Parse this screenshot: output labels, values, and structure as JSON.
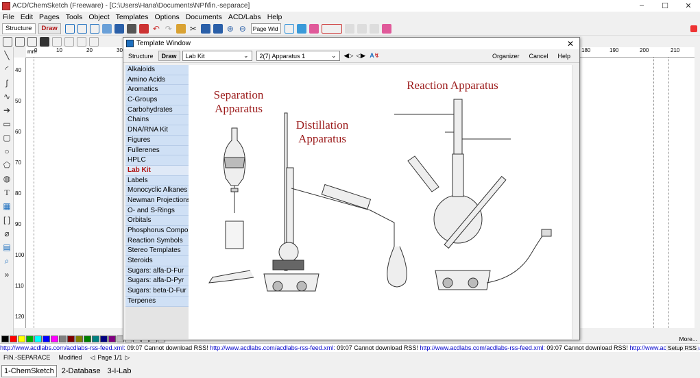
{
  "window": {
    "title": "ACD/ChemSketch (Freeware) - [C:\\Users\\Hana\\Documents\\NPI\\fin.-separace]",
    "controls": [
      "–",
      "☐",
      "✕"
    ]
  },
  "menu": [
    "File",
    "Edit",
    "Pages",
    "Tools",
    "Object",
    "Templates",
    "Options",
    "Documents",
    "ACD/Labs",
    "Help"
  ],
  "toolbar": {
    "structure_label": "Structure",
    "draw_label": "Draw",
    "zoom_value": "Page Wid"
  },
  "ruler": {
    "unit": "mm",
    "h_labels": [
      "0",
      "10",
      "20",
      "30",
      "180",
      "190",
      "200",
      "210"
    ],
    "v_labels": [
      "40",
      "50",
      "60",
      "70",
      "80",
      "90",
      "100",
      "110",
      "120"
    ]
  },
  "template_window": {
    "title": "Template Window",
    "structure_label": "Structure",
    "draw_label": "Draw",
    "category_value": "Lab Kit",
    "page_value": "2(7) Apparatus 1",
    "organizer_label": "Organizer",
    "cancel_label": "Cancel",
    "help_label": "Help",
    "list": [
      "Alkaloids",
      "Amino Acids",
      "Aromatics",
      "C-Groups",
      "Carbohydrates",
      "Chains",
      "DNA/RNA Kit",
      "Figures",
      "Fullerenes",
      "HPLC",
      "Lab Kit",
      "Labels",
      "Monocyclic Alkanes",
      "Newman Projections",
      "O- and S-Rings",
      "Orbitals",
      "Phosphorus Compounds",
      "Reaction Symbols",
      "Stereo Templates",
      "Steroids",
      "Sugars: alfa-D-Fur",
      "Sugars: alfa-D-Pyr",
      "Sugars: beta-D-Fur",
      "Terpenes"
    ],
    "selected": "Lab Kit",
    "preview": {
      "separation_line1": "Separation",
      "separation_line2": "Apparatus",
      "distillation_line1": "Distillation",
      "distillation_line2": "Apparatus",
      "reaction": "Reaction Apparatus"
    }
  },
  "rss": {
    "link": "http://www.acdlabs.com/acdlabs-rss-feed.xml:",
    "message": " 09:07 Cannot download RSS! ",
    "setup_label": "Setup RSS",
    "more_label": "More..."
  },
  "status": {
    "file": "FIN.-SEPARACE",
    "state": "Modified",
    "page": "Page 1/1"
  },
  "bottom_tabs": [
    "1-ChemSketch",
    "2-Database",
    "3-I-Lab"
  ],
  "colors": {
    "accent_red": "#b01010",
    "list_blue": "#cfe0f5",
    "label_red": "#9b1a1a"
  },
  "palette_colors": [
    "#000000",
    "#ff0000",
    "#ffff00",
    "#00b000",
    "#00ffff",
    "#0000ff",
    "#ff00ff",
    "#808080",
    "#800000",
    "#808000",
    "#008000",
    "#008080",
    "#000080",
    "#800080",
    "#c0c0c0",
    "#ffffff",
    "#ffffff",
    "#ffffff",
    "#ffffff",
    "#ffffff"
  ]
}
